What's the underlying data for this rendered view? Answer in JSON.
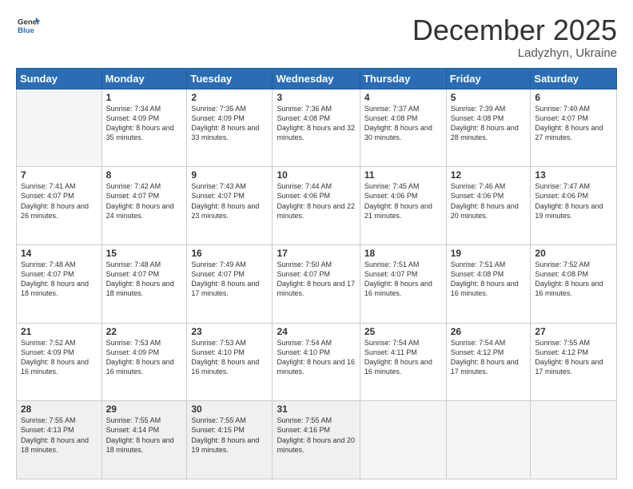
{
  "logo": {
    "general": "General",
    "blue": "Blue"
  },
  "title": "December 2025",
  "location": "Ladyzhyn, Ukraine",
  "days_header": [
    "Sunday",
    "Monday",
    "Tuesday",
    "Wednesday",
    "Thursday",
    "Friday",
    "Saturday"
  ],
  "weeks": [
    [
      {
        "day": "",
        "sunrise": "",
        "sunset": "",
        "daylight": ""
      },
      {
        "day": "1",
        "sunrise": "Sunrise: 7:34 AM",
        "sunset": "Sunset: 4:09 PM",
        "daylight": "Daylight: 8 hours and 35 minutes."
      },
      {
        "day": "2",
        "sunrise": "Sunrise: 7:35 AM",
        "sunset": "Sunset: 4:09 PM",
        "daylight": "Daylight: 8 hours and 33 minutes."
      },
      {
        "day": "3",
        "sunrise": "Sunrise: 7:36 AM",
        "sunset": "Sunset: 4:08 PM",
        "daylight": "Daylight: 8 hours and 32 minutes."
      },
      {
        "day": "4",
        "sunrise": "Sunrise: 7:37 AM",
        "sunset": "Sunset: 4:08 PM",
        "daylight": "Daylight: 8 hours and 30 minutes."
      },
      {
        "day": "5",
        "sunrise": "Sunrise: 7:39 AM",
        "sunset": "Sunset: 4:08 PM",
        "daylight": "Daylight: 8 hours and 28 minutes."
      },
      {
        "day": "6",
        "sunrise": "Sunrise: 7:40 AM",
        "sunset": "Sunset: 4:07 PM",
        "daylight": "Daylight: 8 hours and 27 minutes."
      }
    ],
    [
      {
        "day": "7",
        "sunrise": "Sunrise: 7:41 AM",
        "sunset": "Sunset: 4:07 PM",
        "daylight": "Daylight: 8 hours and 26 minutes."
      },
      {
        "day": "8",
        "sunrise": "Sunrise: 7:42 AM",
        "sunset": "Sunset: 4:07 PM",
        "daylight": "Daylight: 8 hours and 24 minutes."
      },
      {
        "day": "9",
        "sunrise": "Sunrise: 7:43 AM",
        "sunset": "Sunset: 4:07 PM",
        "daylight": "Daylight: 8 hours and 23 minutes."
      },
      {
        "day": "10",
        "sunrise": "Sunrise: 7:44 AM",
        "sunset": "Sunset: 4:06 PM",
        "daylight": "Daylight: 8 hours and 22 minutes."
      },
      {
        "day": "11",
        "sunrise": "Sunrise: 7:45 AM",
        "sunset": "Sunset: 4:06 PM",
        "daylight": "Daylight: 8 hours and 21 minutes."
      },
      {
        "day": "12",
        "sunrise": "Sunrise: 7:46 AM",
        "sunset": "Sunset: 4:06 PM",
        "daylight": "Daylight: 8 hours and 20 minutes."
      },
      {
        "day": "13",
        "sunrise": "Sunrise: 7:47 AM",
        "sunset": "Sunset: 4:06 PM",
        "daylight": "Daylight: 8 hours and 19 minutes."
      }
    ],
    [
      {
        "day": "14",
        "sunrise": "Sunrise: 7:48 AM",
        "sunset": "Sunset: 4:07 PM",
        "daylight": "Daylight: 8 hours and 18 minutes."
      },
      {
        "day": "15",
        "sunrise": "Sunrise: 7:48 AM",
        "sunset": "Sunset: 4:07 PM",
        "daylight": "Daylight: 8 hours and 18 minutes."
      },
      {
        "day": "16",
        "sunrise": "Sunrise: 7:49 AM",
        "sunset": "Sunset: 4:07 PM",
        "daylight": "Daylight: 8 hours and 17 minutes."
      },
      {
        "day": "17",
        "sunrise": "Sunrise: 7:50 AM",
        "sunset": "Sunset: 4:07 PM",
        "daylight": "Daylight: 8 hours and 17 minutes."
      },
      {
        "day": "18",
        "sunrise": "Sunrise: 7:51 AM",
        "sunset": "Sunset: 4:07 PM",
        "daylight": "Daylight: 8 hours and 16 minutes."
      },
      {
        "day": "19",
        "sunrise": "Sunrise: 7:51 AM",
        "sunset": "Sunset: 4:08 PM",
        "daylight": "Daylight: 8 hours and 16 minutes."
      },
      {
        "day": "20",
        "sunrise": "Sunrise: 7:52 AM",
        "sunset": "Sunset: 4:08 PM",
        "daylight": "Daylight: 8 hours and 16 minutes."
      }
    ],
    [
      {
        "day": "21",
        "sunrise": "Sunrise: 7:52 AM",
        "sunset": "Sunset: 4:09 PM",
        "daylight": "Daylight: 8 hours and 16 minutes."
      },
      {
        "day": "22",
        "sunrise": "Sunrise: 7:53 AM",
        "sunset": "Sunset: 4:09 PM",
        "daylight": "Daylight: 8 hours and 16 minutes."
      },
      {
        "day": "23",
        "sunrise": "Sunrise: 7:53 AM",
        "sunset": "Sunset: 4:10 PM",
        "daylight": "Daylight: 8 hours and 16 minutes."
      },
      {
        "day": "24",
        "sunrise": "Sunrise: 7:54 AM",
        "sunset": "Sunset: 4:10 PM",
        "daylight": "Daylight: 8 hours and 16 minutes."
      },
      {
        "day": "25",
        "sunrise": "Sunrise: 7:54 AM",
        "sunset": "Sunset: 4:11 PM",
        "daylight": "Daylight: 8 hours and 16 minutes."
      },
      {
        "day": "26",
        "sunrise": "Sunrise: 7:54 AM",
        "sunset": "Sunset: 4:12 PM",
        "daylight": "Daylight: 8 hours and 17 minutes."
      },
      {
        "day": "27",
        "sunrise": "Sunrise: 7:55 AM",
        "sunset": "Sunset: 4:12 PM",
        "daylight": "Daylight: 8 hours and 17 minutes."
      }
    ],
    [
      {
        "day": "28",
        "sunrise": "Sunrise: 7:55 AM",
        "sunset": "Sunset: 4:13 PM",
        "daylight": "Daylight: 8 hours and 18 minutes."
      },
      {
        "day": "29",
        "sunrise": "Sunrise: 7:55 AM",
        "sunset": "Sunset: 4:14 PM",
        "daylight": "Daylight: 8 hours and 18 minutes."
      },
      {
        "day": "30",
        "sunrise": "Sunrise: 7:55 AM",
        "sunset": "Sunset: 4:15 PM",
        "daylight": "Daylight: 8 hours and 19 minutes."
      },
      {
        "day": "31",
        "sunrise": "Sunrise: 7:55 AM",
        "sunset": "Sunset: 4:16 PM",
        "daylight": "Daylight: 8 hours and 20 minutes."
      },
      {
        "day": "",
        "sunrise": "",
        "sunset": "",
        "daylight": ""
      },
      {
        "day": "",
        "sunrise": "",
        "sunset": "",
        "daylight": ""
      },
      {
        "day": "",
        "sunrise": "",
        "sunset": "",
        "daylight": ""
      }
    ]
  ]
}
